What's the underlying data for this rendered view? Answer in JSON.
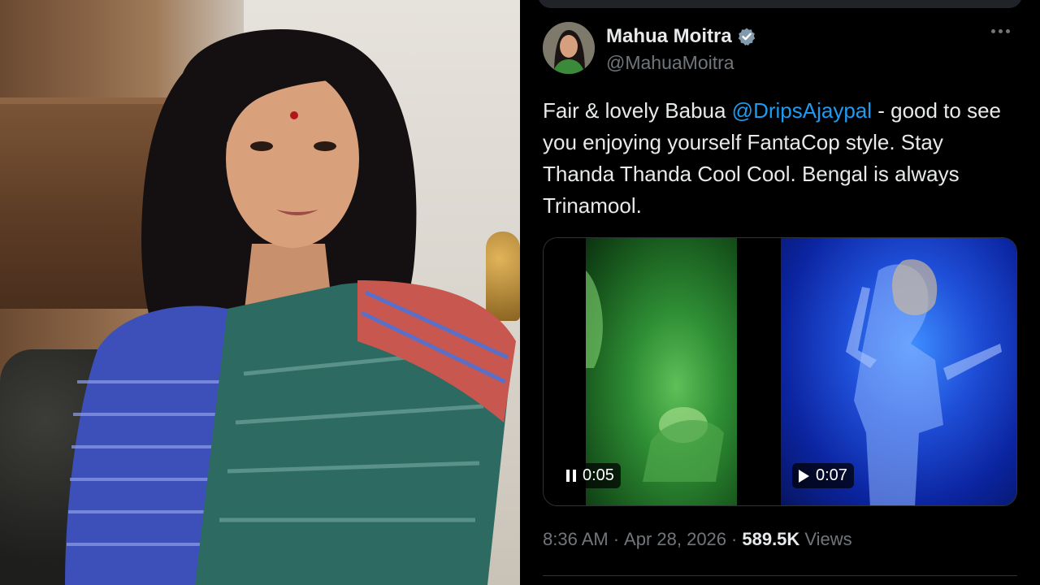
{
  "tweet": {
    "display_name": "Mahua Moitra",
    "handle": "@MahuaMoitra",
    "text_before": "Fair & lovely Babua ",
    "mention": "@DripsAjaypal",
    "text_after": " - good to see you enjoying yourself FantaCop style. Stay Thanda Thanda Cool Cool. Bengal is always Trinamool.",
    "time": "8:36 AM",
    "separator": "·",
    "date": "Apr 28, 2026",
    "views_count": "589.5K",
    "views_label": "Views"
  },
  "media": {
    "video1": {
      "duration": "0:05",
      "state_icon": "pause-icon"
    },
    "video2": {
      "duration": "0:07",
      "state_icon": "play-icon"
    }
  },
  "icons": {
    "verified": "verified-badge-icon",
    "more": "more-options-icon"
  },
  "colors": {
    "background": "#000000",
    "text_primary": "#e7e9ea",
    "text_secondary": "#71767b",
    "mention": "#1d9bf0",
    "verified_badge": "#829aab"
  }
}
